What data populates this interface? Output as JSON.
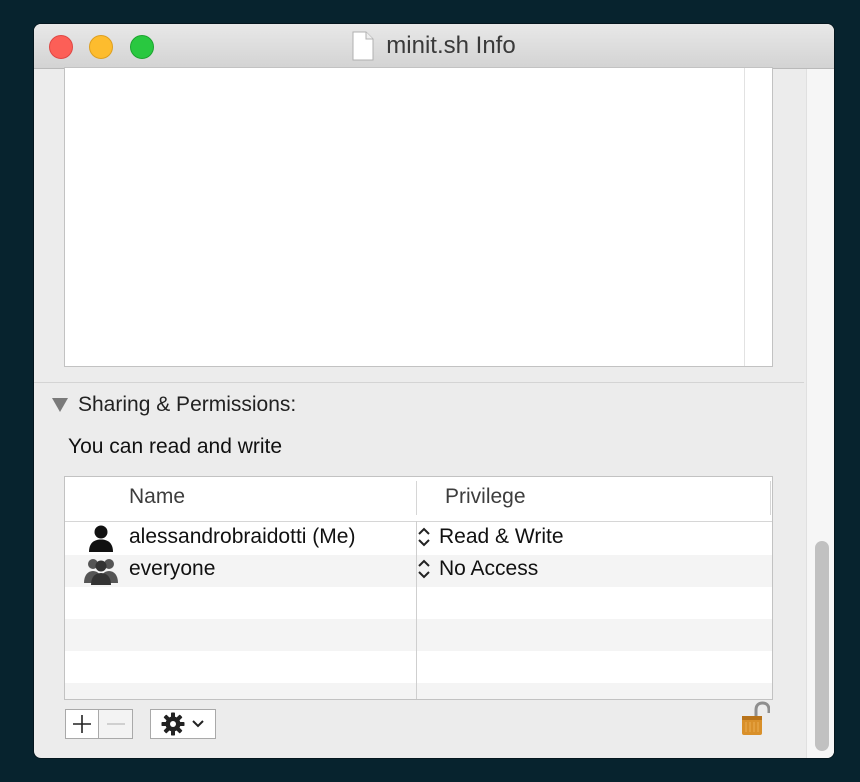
{
  "window": {
    "title": "minit.sh Info"
  },
  "sharing": {
    "header": "Sharing & Permissions:",
    "status": "You can read and write",
    "columns": {
      "name": "Name",
      "privilege": "Privilege"
    },
    "rows": [
      {
        "name": "alessandrobraidotti (Me)",
        "privilege": "Read & Write",
        "icon": "user-icon"
      },
      {
        "name": "everyone",
        "privilege": "No Access",
        "icon": "group-icon"
      }
    ]
  },
  "toolbar": {
    "add_icon": "plus-icon",
    "remove_icon": "minus-icon",
    "action_icon": "gear-icon",
    "lock_icon": "unlocked-padlock-icon"
  },
  "colors": {
    "close": "#fc5f57",
    "minimize": "#fdbc2e",
    "zoom": "#29c840",
    "lock": "#d9902a"
  }
}
